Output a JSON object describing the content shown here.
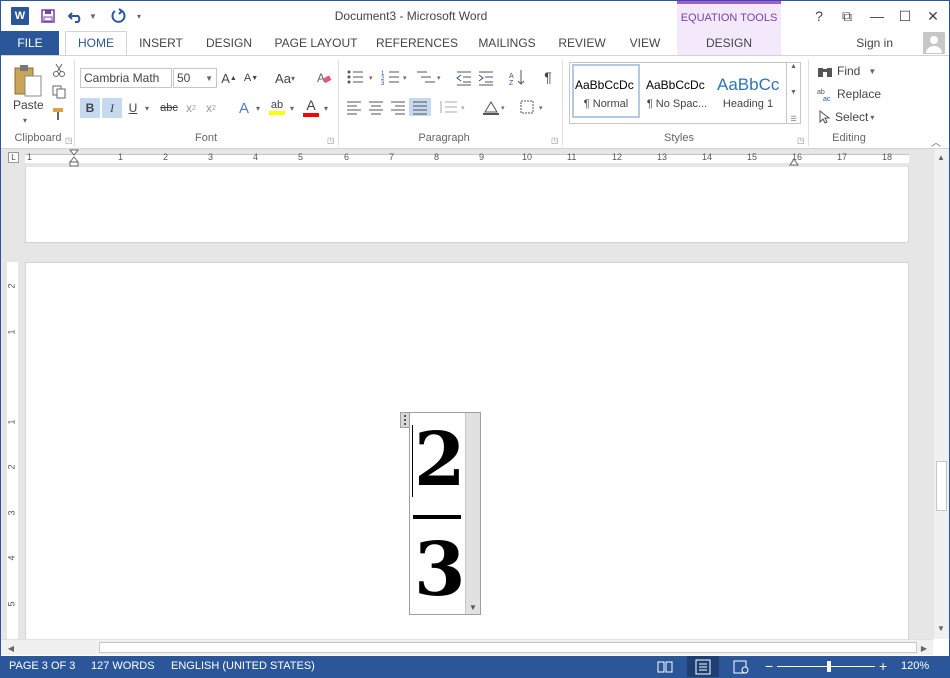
{
  "titlebar": {
    "app_icon": "W",
    "title": "Document3 - Microsoft Word",
    "contextual_header": "EQUATION TOOLS",
    "help": "?",
    "ribbon_display": "⧉",
    "minimize": "—",
    "maximize": "☐",
    "close": "✕",
    "save_icon": "save-icon",
    "undo_icon": "undo-icon",
    "redo_icon": "redo-icon"
  },
  "tabs": {
    "file": "FILE",
    "items": [
      "HOME",
      "INSERT",
      "DESIGN",
      "PAGE LAYOUT",
      "REFERENCES",
      "MAILINGS",
      "REVIEW",
      "VIEW",
      "DESIGN"
    ],
    "signin": "Sign in"
  },
  "ribbon": {
    "clipboard": {
      "paste": "Paste",
      "label": "Clipboard"
    },
    "font": {
      "font_name": "Cambria Math",
      "font_size": "50",
      "grow": "A",
      "shrink": "A",
      "change_case": "Aa",
      "bold": "B",
      "italic": "I",
      "underline": "U",
      "strike": "abc",
      "subscript": "x",
      "subscript_mark": "2",
      "superscript": "x",
      "superscript_mark": "2",
      "text_effects": "A",
      "highlight": "ab",
      "font_color": "A",
      "label": "Font"
    },
    "paragraph": {
      "pilcrow": "¶",
      "label": "Paragraph"
    },
    "styles": {
      "items": [
        {
          "sample": "AaBbCcDc",
          "name": "¶ Normal"
        },
        {
          "sample": "AaBbCcDc",
          "name": "¶ No Spac..."
        },
        {
          "sample": "AaBbCc",
          "name": "Heading 1"
        }
      ],
      "label": "Styles"
    },
    "editing": {
      "find": "Find",
      "replace": "Replace",
      "select": "Select",
      "label": "Editing"
    }
  },
  "ruler": {
    "corner": "L",
    "ticks": [
      "1",
      "1",
      "2",
      "3",
      "4",
      "5",
      "6",
      "7",
      "8",
      "9",
      "10",
      "11",
      "12",
      "13",
      "14",
      "15",
      "16",
      "17",
      "18"
    ],
    "vticks": [
      "2",
      "1",
      "1",
      "2",
      "3",
      "4",
      "5"
    ]
  },
  "equation": {
    "numerator": "2",
    "denominator": "3",
    "font_size": "50"
  },
  "status": {
    "page": "PAGE 3 OF 3",
    "words": "127 WORDS",
    "language": "ENGLISH (UNITED STATES)",
    "zoom_minus": "−",
    "zoom_plus": "+",
    "zoom": "120%"
  },
  "colors": {
    "accent": "#2b579a",
    "contextual": "#a55ad6",
    "contextual_bg": "#f3e9fa"
  }
}
